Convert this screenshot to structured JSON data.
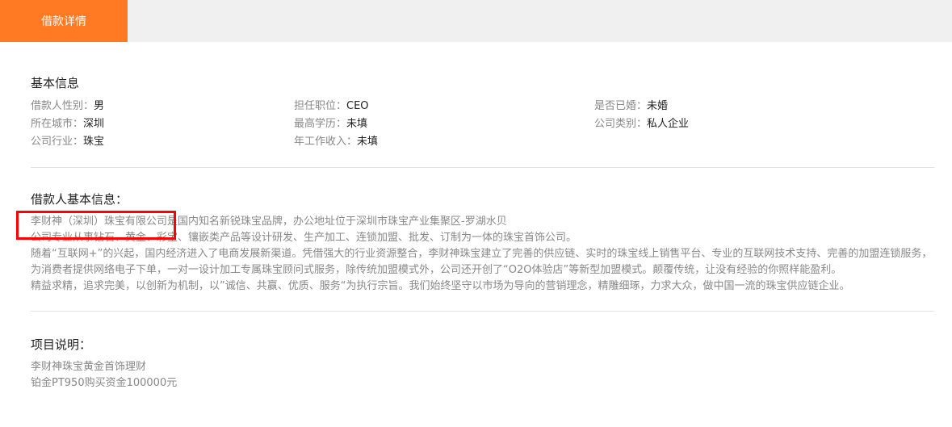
{
  "tabs": [
    {
      "label": "借款详情",
      "active": true
    }
  ],
  "basic_info": {
    "title": "基本信息",
    "fields": [
      {
        "label": "借款人性别：",
        "value": "男"
      },
      {
        "label": "担任职位：",
        "value": "CEO"
      },
      {
        "label": "是否已婚：",
        "value": "未婚"
      },
      {
        "label": "所在城市：",
        "value": "深圳"
      },
      {
        "label": "最高学历：",
        "value": "未填"
      },
      {
        "label": "公司类别：",
        "value": "私人企业"
      },
      {
        "label": "公司行业：",
        "value": "珠宝"
      },
      {
        "label": "年工作收入：",
        "value": "未填"
      }
    ]
  },
  "borrower_info": {
    "title": "借款人基本信息：",
    "lines": [
      "李财神（深圳）珠宝有限公司是国内知名新锐珠宝品牌，办公地址位于深圳市珠宝产业集聚区-罗湖水贝",
      "公司专业从事钻石、黄金、彩宝、镶嵌类产品等设计研发、生产加工、连锁加盟、批发、订制为一体的珠宝首饰公司。",
      "随着“互联网+”的兴起，国内经济进入了电商发展新渠道。凭借强大的行业资源整合，李财神珠宝建立了完善的供应链、实时的珠宝线上销售平台、专业的互联网技术支持、完善的加盟连锁服务，为消费者提供网络电子下单，一对一设计加工专属珠宝顾问式服务，除传统加盟模式外，公司还开创了“O2O体验店”等新型加盟模式。颠覆传统，让没有经验的你照样能盈利。",
      "精益求精，追求完美，以创新为机制，以”诚信、共赢、优质、服务“为执行宗旨。我们始终坚守以市场为导向的营销理念，精雕细琢，力求大众，做中国一流的珠宝供应链企业。"
    ]
  },
  "project": {
    "title": "项目说明：",
    "lines": [
      "李财神珠宝黄金首饰理财",
      "铂金PT950购买资金100000元"
    ]
  },
  "colors": {
    "accent": "#ff7a22",
    "highlight": "#ff0000"
  }
}
